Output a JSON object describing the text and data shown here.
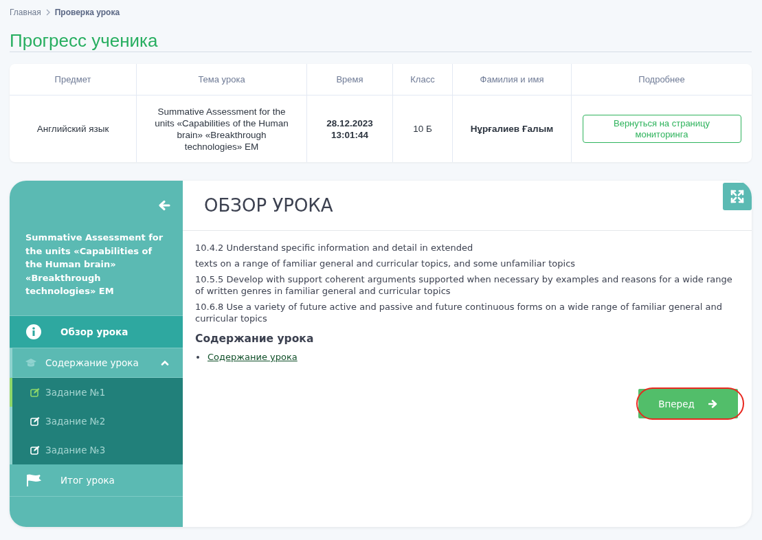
{
  "breadcrumb": [
    {
      "label": "Главная",
      "current": false
    },
    {
      "label": "Проверка урока",
      "current": true
    }
  ],
  "page_title": "Прогресс ученика",
  "table": {
    "columns": [
      "Предмет",
      "Тема урока",
      "Время",
      "Класс",
      "Фамилия и имя",
      "Подробнее"
    ],
    "row": {
      "subject": "Английский язык",
      "topic": "Summative Assessment for the units «Capabilities of the Human brain» «Breakthrough technologies» EM",
      "time": [
        "28.12.2023",
        "13:01:44"
      ],
      "class": "10 Б",
      "student": "Нұрғалиев Ғалым",
      "button": "Вернуться на страницу мониторинга"
    }
  },
  "sidebar": {
    "title": "Summative Assessment for the units «Capabilities of the Human brain» «Breakthrough technologies» EM",
    "items": [
      {
        "kind": "info",
        "label": "Обзор урока",
        "selected": true
      },
      {
        "kind": "section",
        "label": "Содержание урока",
        "selected": false,
        "expanded": true,
        "children": [
          {
            "label": "Задание №1",
            "selected": true
          },
          {
            "label": "Задание №2",
            "selected": false
          },
          {
            "label": "Задание №3",
            "selected": false
          }
        ]
      },
      {
        "kind": "flag",
        "label": "Итог урока",
        "selected": false
      }
    ]
  },
  "content": {
    "heading": "ОБЗОР УРОКА",
    "paragraphs": [
      "10.4.2 Understand specific information and detail in extended",
      "texts on a range of familiar general and curricular topics, and some unfamiliar topics",
      "10.5.5 Develop with support coherent arguments supported when necessary by examples and reasons for a wide range of written genres in familiar general and curricular topics",
      "10.6.8 Use a variety of future active and passive and future continuous forms on a wide range of familiar general and curricular topics"
    ],
    "subheading": "Содержание урока",
    "links": [
      "Содержание урока"
    ],
    "next_button": {
      "label": "Вперед",
      "highlighted": true
    }
  }
}
